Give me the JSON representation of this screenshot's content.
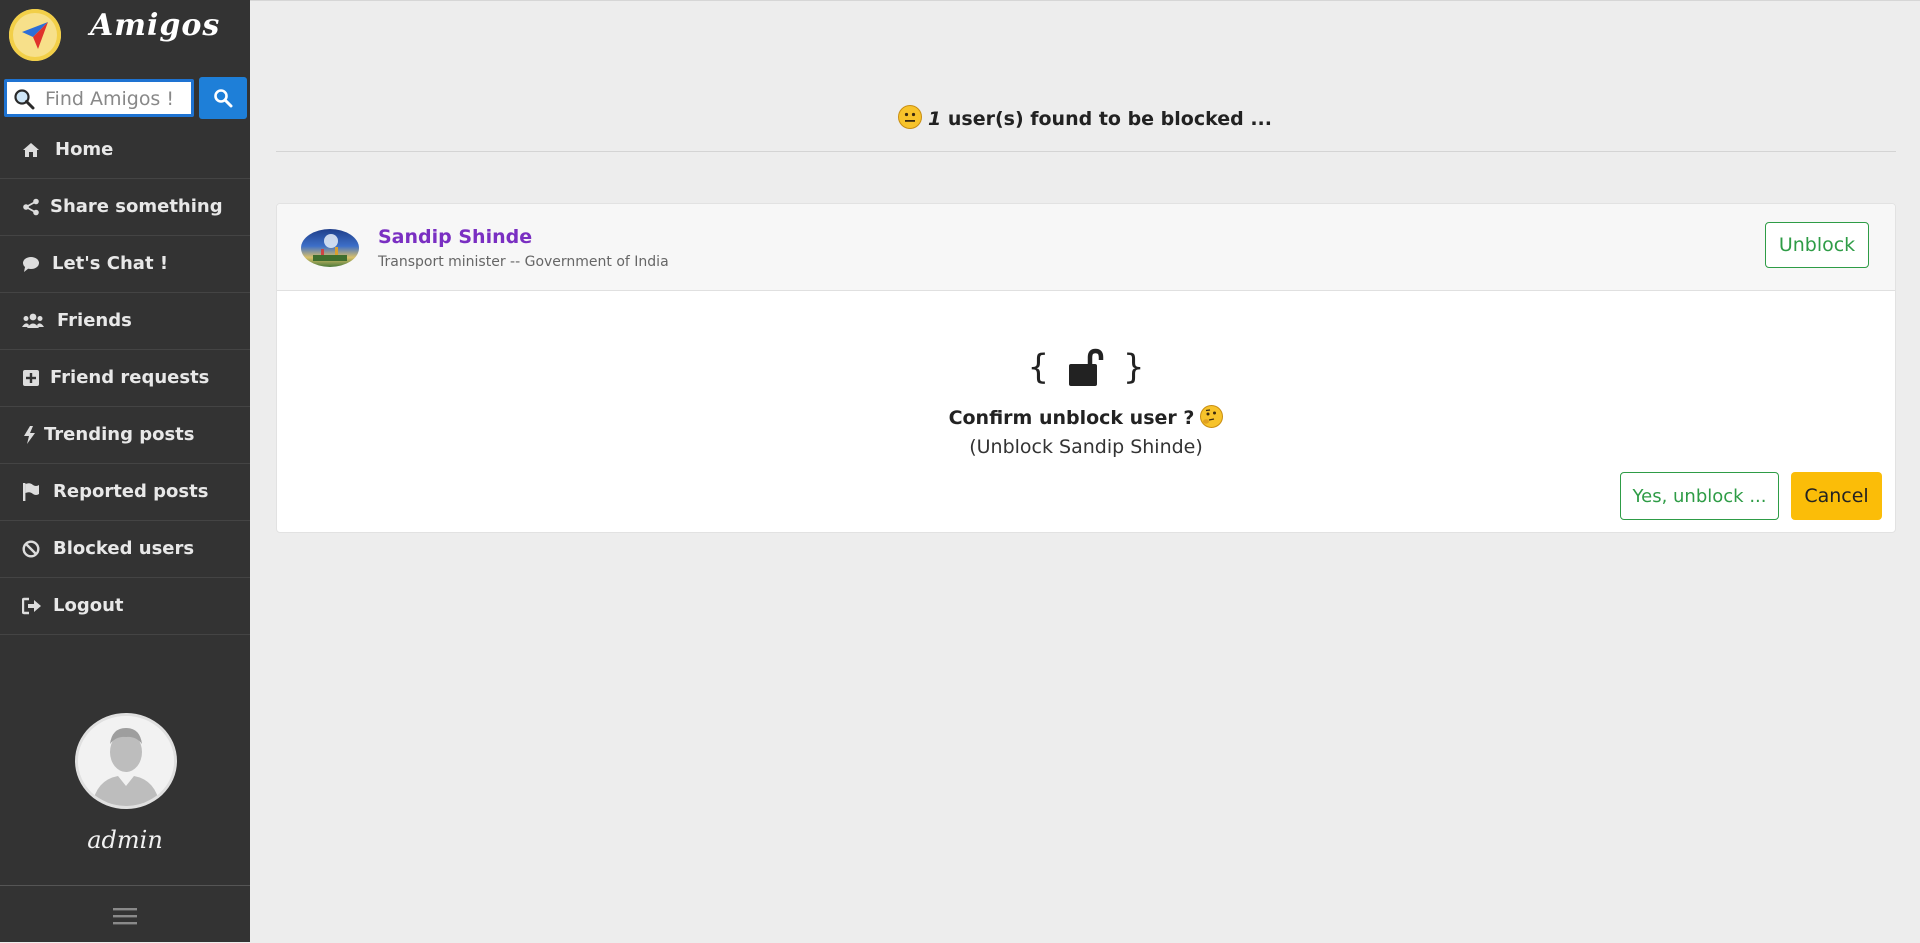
{
  "app": {
    "name": "Amigos"
  },
  "search": {
    "placeholder": "Find Amigos !",
    "value": ""
  },
  "sidebar": {
    "items": [
      {
        "label": "Home",
        "icon": "home-icon"
      },
      {
        "label": "Share something",
        "icon": "share-icon"
      },
      {
        "label": "Let's Chat !",
        "icon": "chat-icon"
      },
      {
        "label": "Friends",
        "icon": "users-icon"
      },
      {
        "label": "Friend requests",
        "icon": "plus-square-icon"
      },
      {
        "label": "Trending posts",
        "icon": "bolt-icon"
      },
      {
        "label": "Reported posts",
        "icon": "flag-icon"
      },
      {
        "label": "Blocked users",
        "icon": "ban-icon"
      },
      {
        "label": "Logout",
        "icon": "sign-out-icon"
      }
    ],
    "profile": {
      "name": "admin"
    }
  },
  "main": {
    "summary": {
      "count": "1",
      "text": "user(s) found to be blocked ..."
    },
    "blocked_users": [
      {
        "name": "Sandip Shinde",
        "description": "Transport minister -- Government of India",
        "unblock_label": "Unblock"
      }
    ],
    "confirm": {
      "brace_open": "{",
      "brace_close": "}",
      "title": "Confirm unblock user ?",
      "subtitle": "(Unblock Sandip Shinde)",
      "yes_label": "Yes, unblock ...",
      "cancel_label": "Cancel"
    }
  },
  "colors": {
    "sidebar_bg": "#333333",
    "accent_blue": "#1e7fd8",
    "user_name": "#7a2fc2",
    "success": "#2e9c46",
    "warning": "#fbbd08"
  }
}
